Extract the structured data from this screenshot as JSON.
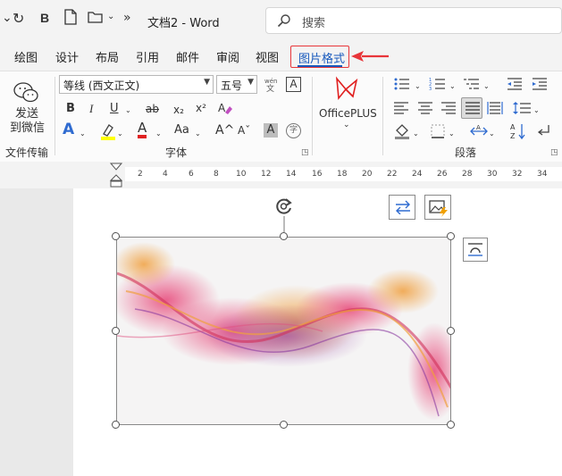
{
  "title_bar": {
    "doc_title": "文档2  -  Word",
    "qa_bold": "B",
    "search_placeholder": "搜索"
  },
  "tabs": [
    "绘图",
    "设计",
    "布局",
    "引用",
    "邮件",
    "审阅",
    "视图"
  ],
  "active_tab": "图片格式",
  "ribbon": {
    "send_wechat_label_1": "发送",
    "send_wechat_label_2": "到微信",
    "group_file_transfer": "文件传输",
    "font_name": "等线 (西文正文)",
    "font_size": "五号",
    "wen_top": "wén",
    "wen_bottom": "文",
    "char_border": "A",
    "bold": "B",
    "italic": "I",
    "underline": "U",
    "strike": "ab",
    "subscript": "x₂",
    "superscript": "x²",
    "text_effect": "A",
    "font_color": "A",
    "change_case": "Aa",
    "grow_font": "A^",
    "shrink_font": "Aˇ",
    "char_shading": "A",
    "enclose_char": "字",
    "group_font": "字体",
    "officeplus_label": "OfficePLUS",
    "group_paragraph": "段落"
  },
  "ruler_ticks": [
    "2",
    "4",
    "6",
    "8",
    "10",
    "12",
    "14",
    "16",
    "18",
    "20",
    "22",
    "24",
    "26",
    "28",
    "30",
    "32",
    "34"
  ],
  "colors": {
    "accent": "#185abd",
    "highlight_red": "#e8363a",
    "highlight_yellow": "#ffff00",
    "font_red": "#e02020"
  }
}
